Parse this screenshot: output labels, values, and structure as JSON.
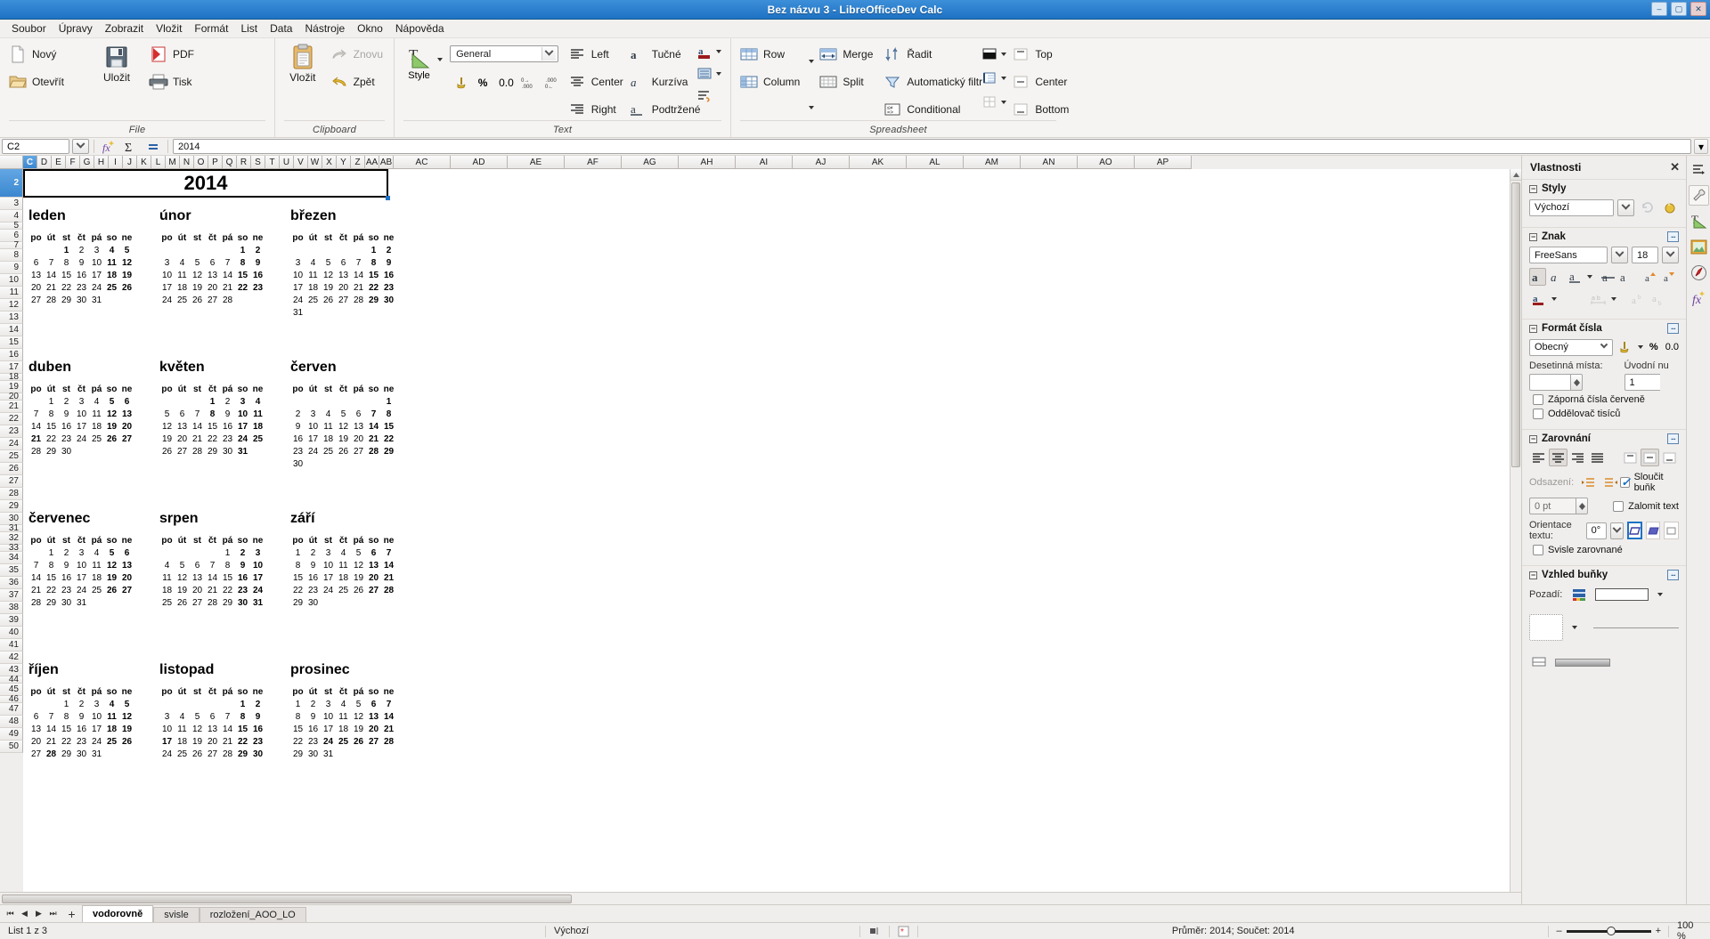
{
  "window": {
    "title": "Bez názvu 3 - LibreOfficeDev Calc",
    "minimize": "–",
    "maximize": "▢",
    "close": "✕"
  },
  "menubar": {
    "items": [
      "Soubor",
      "Úpravy",
      "Zobrazit",
      "Vložit",
      "Formát",
      "List",
      "Data",
      "Nástroje",
      "Okno",
      "Nápověda"
    ]
  },
  "ribbon": {
    "groups": [
      {
        "label": "File",
        "buttons": [
          "Nový",
          "Otevřít",
          "Uložit",
          "PDF",
          "Tisk"
        ]
      },
      {
        "label": "Clipboard",
        "buttons": [
          "Vložit",
          "Znovu",
          "Zpět"
        ]
      },
      {
        "label": "Text",
        "buttons": [
          "Style",
          "Left",
          "Center",
          "Right",
          "Tučné",
          "Kurzíva",
          "Podtržené"
        ]
      },
      {
        "label": "Spreadsheet",
        "buttons": [
          "Row",
          "Column",
          "Merge",
          "Split",
          "Řadit",
          "Automatický filtr",
          "Conditional",
          "Top",
          "Center",
          "Bottom"
        ]
      }
    ],
    "file": {
      "new": "Nový",
      "open": "Otevřít",
      "save": "Uložit",
      "pdf": "PDF",
      "print": "Tisk"
    },
    "clipboard": {
      "paste": "Vložit",
      "redo": "Znovu",
      "undo": "Zpět"
    },
    "text": {
      "style": "Style",
      "format_value": "General",
      "currency": "currency-icon",
      "percent": "%",
      "number": "0.0",
      "add_decimal": "add-decimal",
      "del_decimal": "delete-decimal",
      "left": "Left",
      "center": "Center",
      "right": "Right",
      "bold": "Tučné",
      "italic": "Kurzíva",
      "underline": "Podtržené"
    },
    "spreadsheet": {
      "row": "Row",
      "column": "Column",
      "merge": "Merge",
      "split": "Split",
      "sort": "Řadit",
      "autofilter": "Automatický filtr",
      "conditional": "Conditional",
      "top": "Top",
      "center": "Center",
      "bottom": "Bottom"
    }
  },
  "formulabar": {
    "namebox": "C2",
    "input": "2014",
    "function_wizard": "function-wizard-icon",
    "sum": "Σ",
    "formula": "=",
    "expand": "▾"
  },
  "grid": {
    "columns": [
      "C",
      "D",
      "E",
      "F",
      "G",
      "H",
      "I",
      "J",
      "K",
      "L",
      "M",
      "N",
      "O",
      "P",
      "Q",
      "R",
      "S",
      "T",
      "U",
      "V",
      "W",
      "X",
      "Y",
      "Z",
      "AA",
      "AB",
      "AC",
      "AD",
      "AE",
      "AF",
      "AG",
      "AH",
      "AI",
      "AJ",
      "AK",
      "AL",
      "AM",
      "AN",
      "AO",
      "AP"
    ],
    "selected_column": "C",
    "rows": [
      2,
      3,
      4,
      5,
      6,
      7,
      8,
      9,
      10,
      11,
      12,
      13,
      14,
      15,
      16,
      17,
      18,
      19,
      20,
      21,
      22,
      23,
      24,
      25,
      26,
      27,
      28,
      29,
      30,
      31,
      32,
      33,
      34,
      35,
      36,
      37,
      38,
      39,
      40,
      41,
      42,
      43,
      44,
      45,
      46,
      47,
      48,
      49,
      50
    ],
    "selected_row": 2,
    "year_cell": "2014"
  },
  "calendar": {
    "year": "2014",
    "daynames": [
      "po",
      "út",
      "st",
      "čt",
      "pá",
      "so",
      "ne"
    ],
    "months": [
      {
        "name": "leden",
        "first_weekday": 2,
        "days": 31,
        "holidays": [
          1
        ]
      },
      {
        "name": "únor",
        "first_weekday": 5,
        "days": 28,
        "holidays": []
      },
      {
        "name": "březen",
        "first_weekday": 5,
        "days": 31,
        "holidays": []
      },
      {
        "name": "duben",
        "first_weekday": 1,
        "days": 30,
        "holidays": [
          21
        ]
      },
      {
        "name": "květen",
        "first_weekday": 3,
        "days": 31,
        "holidays": [
          1,
          8
        ]
      },
      {
        "name": "červen",
        "first_weekday": 6,
        "days": 30,
        "holidays": []
      },
      {
        "name": "červenec",
        "first_weekday": 1,
        "days": 31,
        "holidays": [
          5,
          6
        ]
      },
      {
        "name": "srpen",
        "first_weekday": 4,
        "days": 31,
        "holidays": []
      },
      {
        "name": "září",
        "first_weekday": 0,
        "days": 30,
        "holidays": [
          28
        ]
      },
      {
        "name": "říjen",
        "first_weekday": 2,
        "days": 31,
        "holidays": [
          28
        ]
      },
      {
        "name": "listopad",
        "first_weekday": 5,
        "days": 30,
        "holidays": [
          17
        ]
      },
      {
        "name": "prosinec",
        "first_weekday": 0,
        "days": 31,
        "holidays": [
          24,
          25,
          26
        ]
      }
    ]
  },
  "sidebar": {
    "title": "Vlastnosti",
    "close": "✕",
    "styles": {
      "title": "Styly",
      "value": "Výchozí"
    },
    "character": {
      "title": "Znak",
      "font": "FreeSans",
      "size": "18",
      "bold": "bold-icon",
      "italic": "italic-icon",
      "underline": "underline-icon",
      "strikethrough": "strikethrough-icon",
      "shadow": "shadow-icon",
      "superscript": "superscript-icon",
      "subscript": "subscript-icon",
      "font_color": "font-color-icon",
      "highlight": "highlight-icon",
      "increase_size": "increase-size-icon",
      "decrease_size": "decrease-size-icon"
    },
    "number_format": {
      "title": "Formát čísla",
      "value": "Obecný",
      "percent": "%",
      "number": "0.0",
      "decimal_label": "Desetinná místa:",
      "decimal_value": "",
      "leading_label": "Úvodní nu",
      "leading_value": "1",
      "negative_red": "Záporná čísla červeně",
      "thousands_sep": "Oddělovač tisíců"
    },
    "alignment": {
      "title": "Zarovnání",
      "indent_label": "Odsazení:",
      "indent_value": "0 pt",
      "orientation_label": "Orientace textu:",
      "orientation_value": "0°",
      "merge_cells": "Sloučit buňk",
      "wrap_text": "Zalomit text",
      "vertically_stacked": "Svisle zarovnané"
    },
    "cell_appearance": {
      "title": "Vzhled buňky",
      "background_label": "Pozadí:"
    },
    "tabs": [
      "properties-tab",
      "styles-tab",
      "gallery-tab",
      "navigator-tab",
      "functions-tab"
    ]
  },
  "tabbar": {
    "first": "⏮",
    "prev": "◀",
    "next": "▶",
    "last": "⏭",
    "add": "+",
    "sheets": [
      {
        "name": "vodorovně",
        "active": true
      },
      {
        "name": "svisle",
        "active": false
      },
      {
        "name": "rozložení_AOO_LO",
        "active": false
      }
    ]
  },
  "statusbar": {
    "sheet_info": "List 1 z 3",
    "page_style": "Výchozí",
    "selection_mode": "selection-mode-icon",
    "modified": "modified-icon",
    "summary": "Průměr: 2014; Součet: 2014",
    "zoom_minus": "–",
    "zoom_plus": "+",
    "zoom_value": "100 %"
  },
  "colors": {
    "accent": "#1f72c4",
    "saturday": "#0057d8",
    "sunday": "#e00000",
    "title_bar": "#2b7fc9"
  }
}
